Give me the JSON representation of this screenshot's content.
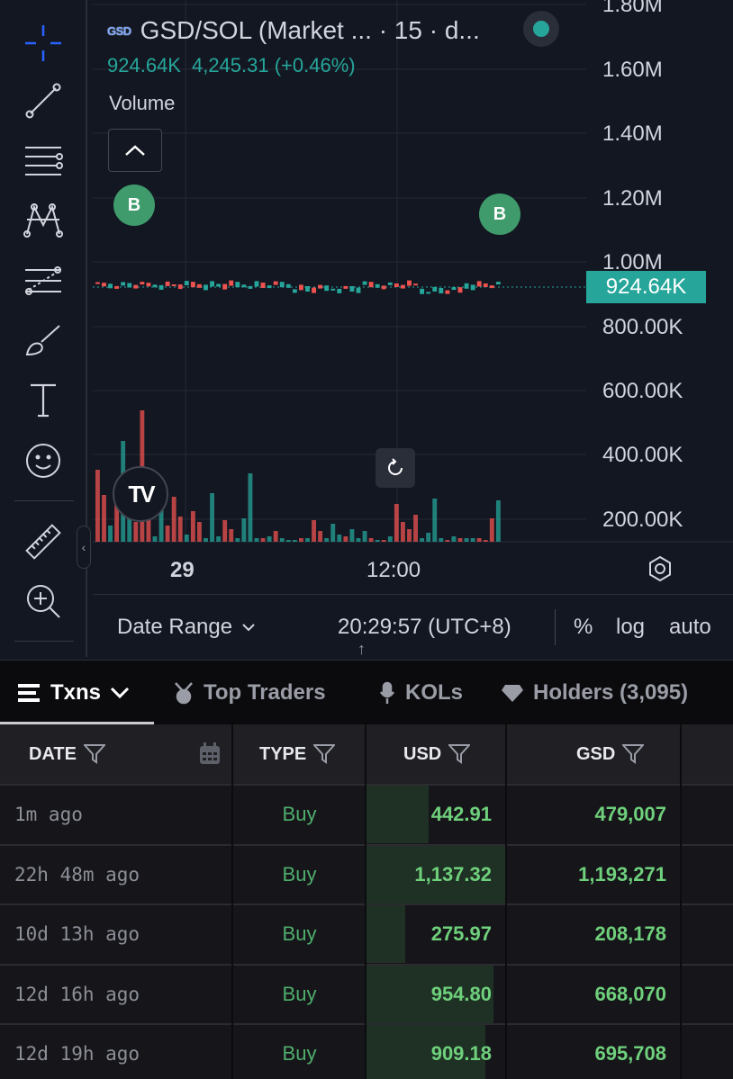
{
  "chart_header": {
    "symbol_logo": "GSD",
    "title": "GSD/SOL (Market ... · 15 · d...",
    "price": "924.64K",
    "change": "4,245.31 (+0.46%)",
    "indicator_label": "Volume"
  },
  "markers": {
    "buy_label": "B"
  },
  "y_axis": {
    "labels": [
      "1.80M",
      "1.60M",
      "1.40M",
      "1.20M",
      "1.00M",
      "800.00K",
      "600.00K",
      "400.00K",
      "200.00K"
    ]
  },
  "last_price": "924.64K",
  "x_axis": {
    "labels": [
      "29",
      "12:00"
    ]
  },
  "bottom_bar": {
    "date_range": "Date Range",
    "clock": "20:29:57 (UTC+8)",
    "percent": "%",
    "log": "log",
    "auto": "auto"
  },
  "tv_logo": "TV",
  "colors": {
    "up": "#26a69a",
    "down": "#ef5350",
    "buy": "#6fd07c"
  },
  "volume_bars": [
    {
      "v": 80,
      "d": "down"
    },
    {
      "v": 52,
      "d": "down"
    },
    {
      "v": 18,
      "d": "up"
    },
    {
      "v": 46,
      "d": "down"
    },
    {
      "v": 112,
      "d": "up"
    },
    {
      "v": 68,
      "d": "up"
    },
    {
      "v": 22,
      "d": "down"
    },
    {
      "v": 146,
      "d": "down"
    },
    {
      "v": 62,
      "d": "down"
    },
    {
      "v": 6,
      "d": "up"
    },
    {
      "v": 58,
      "d": "up"
    },
    {
      "v": 18,
      "d": "down"
    },
    {
      "v": 50,
      "d": "down"
    },
    {
      "v": 28,
      "d": "down"
    },
    {
      "v": 8,
      "d": "up"
    },
    {
      "v": 34,
      "d": "down"
    },
    {
      "v": 22,
      "d": "down"
    },
    {
      "v": 4,
      "d": "up"
    },
    {
      "v": 54,
      "d": "up"
    },
    {
      "v": 6,
      "d": "up"
    },
    {
      "v": 24,
      "d": "down"
    },
    {
      "v": 14,
      "d": "down"
    },
    {
      "v": 4,
      "d": "up"
    },
    {
      "v": 26,
      "d": "up"
    },
    {
      "v": 76,
      "d": "up"
    },
    {
      "v": 4,
      "d": "up"
    },
    {
      "v": 4,
      "d": "down"
    },
    {
      "v": 6,
      "d": "up"
    },
    {
      "v": 12,
      "d": "down"
    },
    {
      "v": 4,
      "d": "up"
    },
    {
      "v": 2,
      "d": "up"
    },
    {
      "v": 2,
      "d": "up"
    },
    {
      "v": 4,
      "d": "down"
    },
    {
      "v": 4,
      "d": "up"
    },
    {
      "v": 24,
      "d": "down"
    },
    {
      "v": 12,
      "d": "down"
    },
    {
      "v": 4,
      "d": "up"
    },
    {
      "v": 20,
      "d": "up"
    },
    {
      "v": 8,
      "d": "up"
    },
    {
      "v": 6,
      "d": "down"
    },
    {
      "v": 14,
      "d": "up"
    },
    {
      "v": 4,
      "d": "up"
    },
    {
      "v": 12,
      "d": "up"
    },
    {
      "v": 4,
      "d": "down"
    },
    {
      "v": 2,
      "d": "up"
    },
    {
      "v": 2,
      "d": "down"
    },
    {
      "v": 6,
      "d": "up"
    },
    {
      "v": 42,
      "d": "down"
    },
    {
      "v": 22,
      "d": "down"
    },
    {
      "v": 14,
      "d": "down"
    },
    {
      "v": 30,
      "d": "down"
    },
    {
      "v": 4,
      "d": "up"
    },
    {
      "v": 10,
      "d": "up"
    },
    {
      "v": 48,
      "d": "up"
    },
    {
      "v": 4,
      "d": "up"
    },
    {
      "v": 2,
      "d": "down"
    },
    {
      "v": 6,
      "d": "up"
    },
    {
      "v": 4,
      "d": "down"
    },
    {
      "v": 4,
      "d": "up"
    },
    {
      "v": 4,
      "d": "up"
    },
    {
      "v": 4,
      "d": "down"
    },
    {
      "v": 2,
      "d": "down"
    },
    {
      "v": 26,
      "d": "down"
    },
    {
      "v": 46,
      "d": "up"
    }
  ],
  "tabs": [
    {
      "label": "Txns",
      "active": true
    },
    {
      "label": "Top Traders"
    },
    {
      "label": "KOLs"
    },
    {
      "label": "Holders (3,095)"
    }
  ],
  "table": {
    "headers": [
      "DATE",
      "TYPE",
      "USD",
      "GSD"
    ],
    "rows": [
      {
        "date": "1m ago",
        "type": "Buy",
        "usd": "442.91",
        "gsd": "479,007",
        "usd_share": 0.45
      },
      {
        "date": "22h 48m ago",
        "type": "Buy",
        "usd": "1,137.32",
        "gsd": "1,193,271",
        "usd_share": 1.0
      },
      {
        "date": "10d 13h ago",
        "type": "Buy",
        "usd": "275.97",
        "gsd": "208,178",
        "usd_share": 0.28
      },
      {
        "date": "12d 16h ago",
        "type": "Buy",
        "usd": "954.80",
        "gsd": "668,070",
        "usd_share": 0.91
      },
      {
        "date": "12d 19h ago",
        "type": "Buy",
        "usd": "909.18",
        "gsd": "695,708",
        "usd_share": 0.85
      }
    ]
  }
}
